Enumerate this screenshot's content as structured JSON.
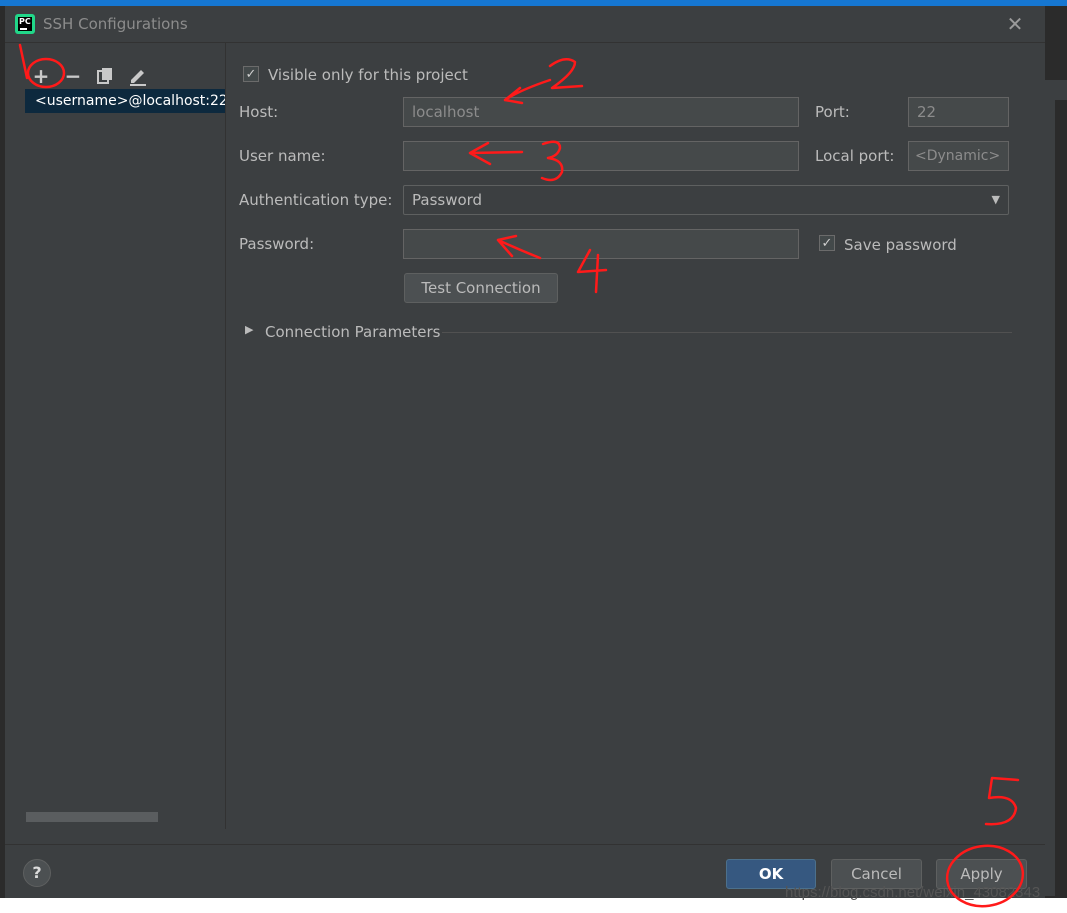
{
  "dialog": {
    "title": "SSH Configurations",
    "app_icon_text": "PC"
  },
  "toolbar": {
    "add_icon": "+",
    "remove_icon": "−",
    "copy_icon": "copy-icon",
    "edit_icon": "edit-icon"
  },
  "config_list": {
    "items": [
      "<username>@localhost:22"
    ]
  },
  "form": {
    "visible_only_label": "Visible only for this project",
    "visible_only_checked": true,
    "host_label": "Host:",
    "host_placeholder": "localhost",
    "host_value": "",
    "port_label": "Port:",
    "port_placeholder": "22",
    "username_label": "User name:",
    "username_value": "",
    "local_port_label": "Local port:",
    "local_port_placeholder": "<Dynamic>",
    "auth_type_label": "Authentication type:",
    "auth_type_value": "Password",
    "password_label": "Password:",
    "password_value": "",
    "save_password_label": "Save password",
    "save_password_checked": true,
    "test_connection_label": "Test Connection",
    "connection_params_label": "Connection Parameters"
  },
  "footer": {
    "help_label": "?",
    "ok_label": "OK",
    "cancel_label": "Cancel",
    "apply_label": "Apply"
  },
  "annotations": {
    "step1": "1",
    "step2": "2",
    "step3": "3",
    "step4": "4",
    "step5": "5",
    "color": "#ff1a1a"
  },
  "watermark": "https://blog.csdn.net/weixin_43082343"
}
